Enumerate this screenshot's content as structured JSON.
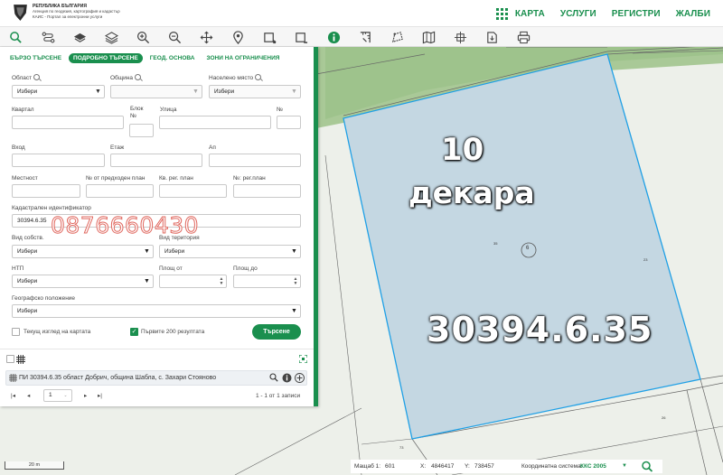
{
  "header": {
    "logo_lines": [
      "РЕПУБЛИКА БЪЛГАРИЯ",
      "Агенция по геодезия, картография и кадастър",
      "КАИС - Портал за електронни услуги"
    ],
    "nav": [
      "КАРТА",
      "УСЛУГИ",
      "РЕГИСТРИ",
      "ЖАЛБИ"
    ]
  },
  "toolbar": {
    "tools": [
      "search-icon",
      "route-icon",
      "layer-icon",
      "layers-stack-icon",
      "zoom-in-icon",
      "zoom-out-icon",
      "pan-icon",
      "location-pin-icon",
      "select-area-icon",
      "deselect-area-icon",
      "info-icon",
      "measure-distance-icon",
      "measure-area-icon",
      "map-book-icon",
      "coordinates-icon",
      "export-icon",
      "print-icon"
    ]
  },
  "panel": {
    "tabs": [
      "БЪРЗО ТЪРСЕНЕ",
      "ПОДРОБНО ТЪРСЕНЕ",
      "ГЕОД. ОСНОВА",
      "ЗОНИ НА ОГРАНИЧЕНИЯ"
    ],
    "active_tab": "ПОДРОБНО ТЪРСЕНЕ",
    "labels": {
      "oblast": "Област",
      "obshtina": "Община",
      "naseleno_myasto": "Населено място",
      "kvartal": "Квартал",
      "blok": "Блок",
      "nomer": "№",
      "ulitsa": "Улица",
      "nomer2": "№",
      "vhod": "Вход",
      "etazh": "Етаж",
      "ap": "Ап",
      "mestnost": "Местност",
      "nomer_predhoden": "№ от предходен план",
      "kv_reg_plan": "Кв. рег. план",
      "nomer_reg_plan": "№: рег.план",
      "kadastralen_id": "Кадастрален идентификатор",
      "vid_sobstv": "Вид собств.",
      "vid_teritoriya": "Вид територия",
      "ntp": "НТП",
      "plosht_ot": "Площ от",
      "plosht_do": "Площ до",
      "geografsko": "Географско положение"
    },
    "values": {
      "oblast": "Избери",
      "naseleno_myasto": "Избери",
      "kadastralen_id": "30394.6.35",
      "vid_sobstv": "Избери",
      "vid_teritoriya": "Избери",
      "ntp": "Избери",
      "geografsko": "Избери"
    },
    "watermark": "0876660430",
    "checkbox_current_view": "Текущ изглед на картата",
    "checkbox_first200": "Първите 200 резултата",
    "search_button": "Търсене",
    "result_text": "ПИ 30394.6.35 област Добрич, община Шабла, с. Захари Стояново",
    "pager": {
      "page": "1",
      "summary": "1 - 1 от 1 записи"
    }
  },
  "map": {
    "overlay_area_number": "10",
    "overlay_area_unit": "декара",
    "overlay_parcel_id": "30394.6.35",
    "parcel_number": "6",
    "small_labels": [
      "35",
      "23",
      "26",
      "73",
      "26"
    ]
  },
  "status": {
    "scale_bar": "20 m",
    "scale_label": "Мащаб 1:",
    "scale_value": "601",
    "x_label": "X:",
    "x_value": "4846417",
    "y_label": "Y:",
    "y_value": "738457",
    "coord_system_label": "Координатна система:",
    "coord_system_value": "ККС 2005"
  },
  "colors": {
    "brand_green": "#1a8f4e",
    "parcel_fill": "#c4d7e2",
    "parcel_border": "#1fa0e6",
    "map_green": "#9fc48a"
  }
}
